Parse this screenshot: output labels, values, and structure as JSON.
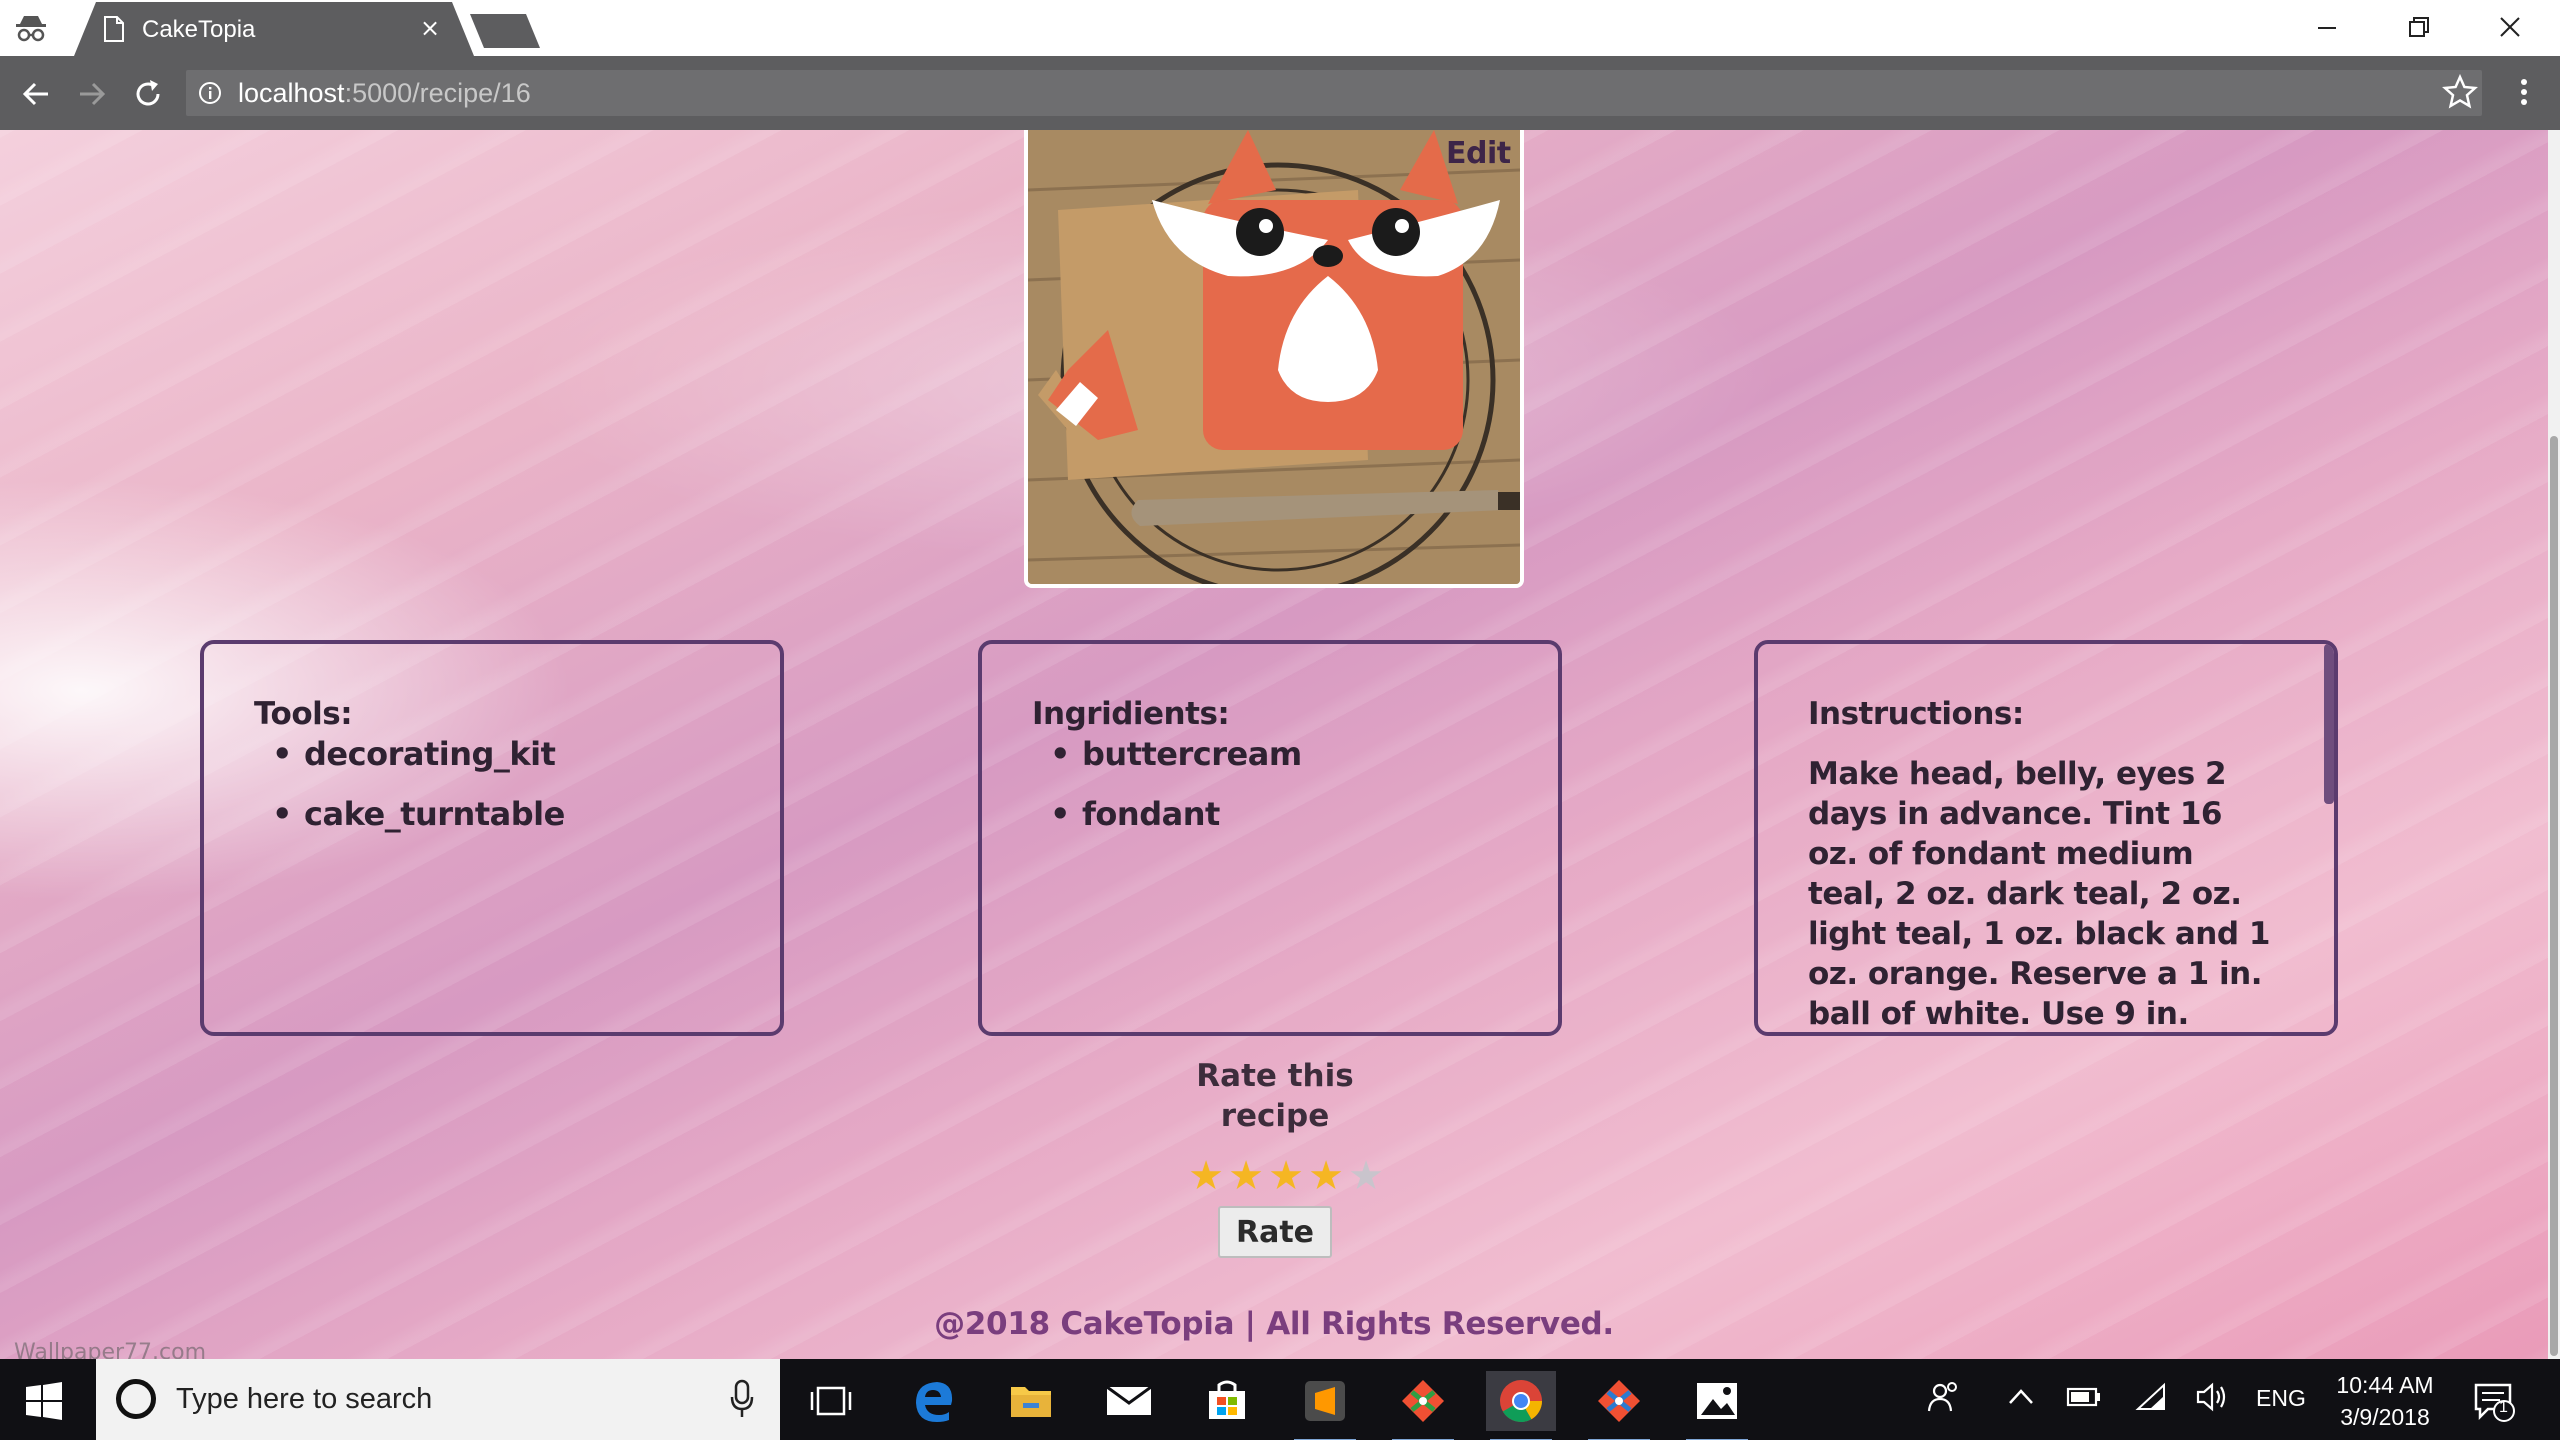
{
  "browser": {
    "tab_title": "CakeTopia",
    "tab_close": "×",
    "url_host": "localhost",
    "url_path": ":5000/recipe/16"
  },
  "page": {
    "edit_label": "Edit",
    "tools": {
      "title": "Tools:",
      "items": [
        "decorating_kit",
        "cake_turntable"
      ]
    },
    "ingredients": {
      "title": "Ingridients:",
      "items": [
        "buttercream",
        "fondant"
      ]
    },
    "instructions": {
      "title": "Instructions:",
      "text": "Make head, belly, eyes 2 days in advance. Tint 16 oz. of fondant medium teal, 2 oz. dark teal, 2 oz. light teal, 1 oz. black and 1 oz. orange. Reserve a 1 in. ball of white. Use 9 in."
    },
    "rating": {
      "heading": "Rate this recipe",
      "value": 4,
      "max": 5,
      "button_label": "Rate"
    },
    "footer": "@2018 CakeTopia | All Rights Reserved.",
    "watermark": "Wallpaper77.com"
  },
  "taskbar": {
    "search_placeholder": "Type here to search",
    "language": "ENG",
    "time": "10:44 AM",
    "date": "3/9/2018",
    "notification_count": "1"
  },
  "colors": {
    "card_border": "#5b3b6e",
    "star_on": "#f5b623",
    "star_off": "#c9c4cc",
    "footer_text": "#7a3e7e"
  }
}
